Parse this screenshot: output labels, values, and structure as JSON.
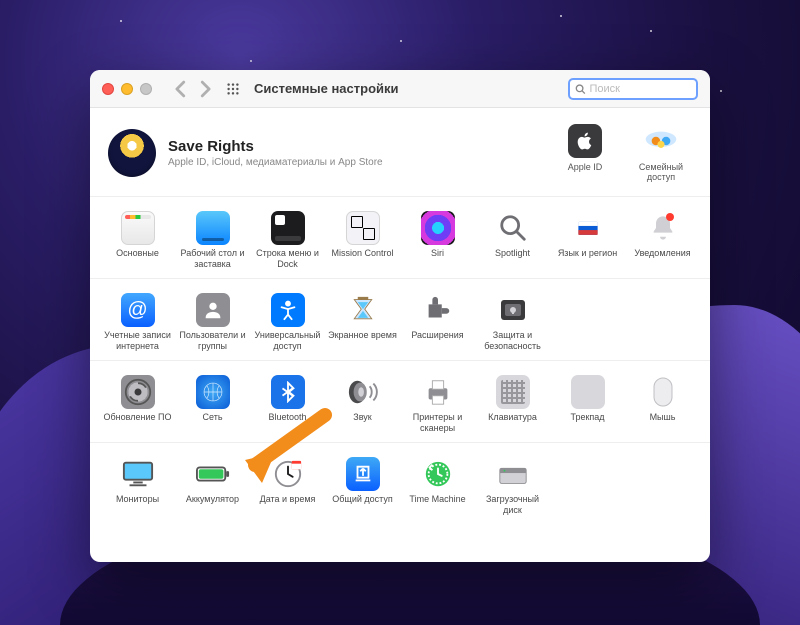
{
  "window": {
    "title": "Системные настройки",
    "search_placeholder": "Поиск"
  },
  "account": {
    "name": "Save Rights",
    "subtitle": "Apple ID, iCloud, медиаматериалы и App Store"
  },
  "header_icons": {
    "apple_id": "Apple ID",
    "family": "Семейный доступ"
  },
  "rows": [
    {
      "items": [
        {
          "id": "general",
          "label": "Основные"
        },
        {
          "id": "desktop",
          "label": "Рабочий стол и заставка"
        },
        {
          "id": "dock",
          "label": "Строка меню и Dock"
        },
        {
          "id": "mission",
          "label": "Mission Control"
        },
        {
          "id": "siri",
          "label": "Siri"
        },
        {
          "id": "spotlight",
          "label": "Spotlight"
        },
        {
          "id": "language",
          "label": "Язык и регион"
        },
        {
          "id": "notif",
          "label": "Уведомления"
        }
      ]
    },
    {
      "items": [
        {
          "id": "internet",
          "label": "Учетные записи интернета"
        },
        {
          "id": "users",
          "label": "Пользователи и группы"
        },
        {
          "id": "access",
          "label": "Универсальный доступ"
        },
        {
          "id": "screentime",
          "label": "Экранное время"
        },
        {
          "id": "ext",
          "label": "Расширения"
        },
        {
          "id": "security",
          "label": "Защита и безопасность"
        }
      ]
    },
    {
      "items": [
        {
          "id": "update",
          "label": "Обновление ПО"
        },
        {
          "id": "network",
          "label": "Сеть"
        },
        {
          "id": "bt",
          "label": "Bluetooth"
        },
        {
          "id": "sound",
          "label": "Звук"
        },
        {
          "id": "print",
          "label": "Принтеры и сканеры"
        },
        {
          "id": "keyboard",
          "label": "Клавиатура"
        },
        {
          "id": "trackpad",
          "label": "Трекпад"
        },
        {
          "id": "mouse",
          "label": "Мышь"
        }
      ]
    },
    {
      "items": [
        {
          "id": "display",
          "label": "Мониторы"
        },
        {
          "id": "battery",
          "label": "Аккумулятор"
        },
        {
          "id": "datetime",
          "label": "Дата и время"
        },
        {
          "id": "sharing",
          "label": "Общий доступ"
        },
        {
          "id": "tm",
          "label": "Time Machine"
        },
        {
          "id": "startup",
          "label": "Загрузочный диск"
        }
      ]
    }
  ],
  "annotation": {
    "target": "update",
    "color": "#f28c1a"
  }
}
